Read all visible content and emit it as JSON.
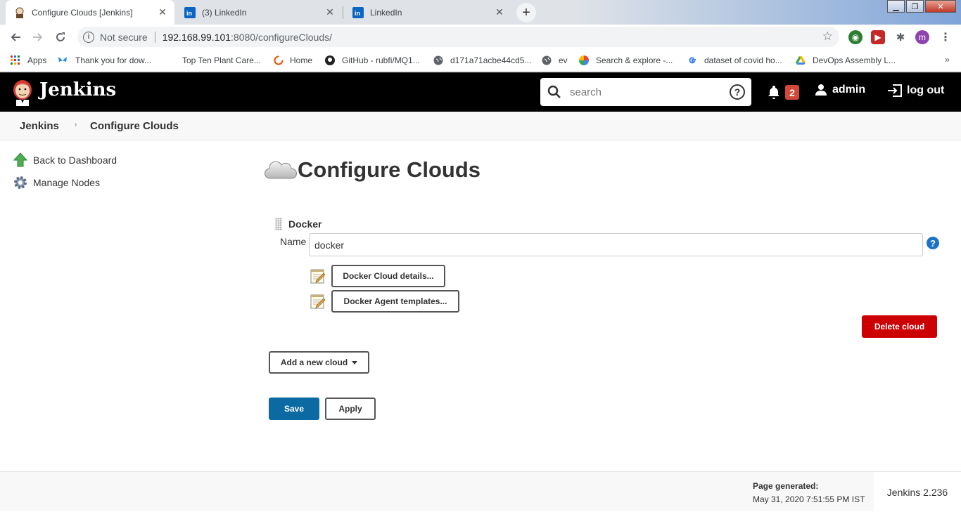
{
  "browser": {
    "tabs": [
      {
        "title": "Configure Clouds [Jenkins]",
        "active": true
      },
      {
        "title": "(3) LinkedIn",
        "active": false
      },
      {
        "title": "LinkedIn",
        "active": false
      }
    ],
    "address": {
      "security_label": "Not secure",
      "host": "192.168.99.101",
      "path": ":8080/configureClouds/"
    },
    "profile_initial": "m",
    "bookmarks": [
      {
        "label": "Apps",
        "icon": "apps-grid-icon"
      },
      {
        "label": "Thank you for dow...",
        "icon": "butterfly-icon"
      },
      {
        "label": "Top Ten Plant Care...",
        "icon": "none"
      },
      {
        "label": "Home",
        "icon": "loading-ring-icon"
      },
      {
        "label": "GitHub - rubfi/MQ1...",
        "icon": "github-icon"
      },
      {
        "label": "d171a71acbe44cd5...",
        "icon": "globe-icon"
      },
      {
        "label": "ev",
        "icon": "globe-icon"
      },
      {
        "label": "Search & explore -...",
        "icon": "pinwheel-icon"
      },
      {
        "label": "dataset of covid ho...",
        "icon": "google-icon"
      },
      {
        "label": "DevOps Assembly L...",
        "icon": "drive-icon"
      }
    ],
    "bookmarks_more": "»"
  },
  "jenkins": {
    "brand": "Jenkins",
    "search_placeholder": "search",
    "notifications_count": "2",
    "user": "admin",
    "logout_label": "log out",
    "breadcrumbs": [
      "Jenkins",
      "Configure Clouds"
    ],
    "sidebar": [
      {
        "label": "Back to Dashboard",
        "icon": "up-arrow-icon"
      },
      {
        "label": "Manage Nodes",
        "icon": "gear-icon"
      }
    ],
    "page_title": "Configure Clouds",
    "cloud": {
      "section_title": "Docker",
      "name_label": "Name",
      "name_value": "docker",
      "details_button": "Docker Cloud details...",
      "templates_button": "Docker Agent templates...",
      "delete_button": "Delete cloud"
    },
    "add_cloud_button": "Add a new cloud",
    "save_button": "Save",
    "apply_button": "Apply",
    "footer": {
      "generated_label": "Page generated:",
      "generated_date": "May 31, 2020 7:51:55 PM IST",
      "version": "Jenkins 2.236"
    }
  },
  "colors": {
    "header_bg": "#000000",
    "badge": "#d24939",
    "delete": "#cc0003",
    "save": "#0b6aa2",
    "help": "#1a73c9"
  }
}
